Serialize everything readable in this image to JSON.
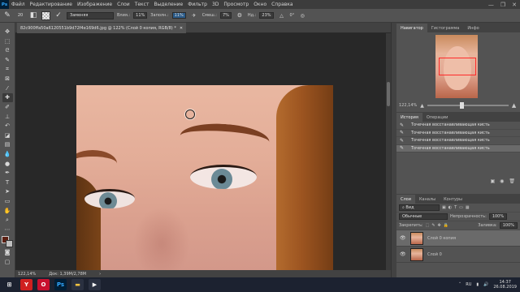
{
  "app": {
    "logo": "Ps"
  },
  "menu": [
    "Файл",
    "Редактирование",
    "Изображение",
    "Слои",
    "Текст",
    "Выделение",
    "Фильтр",
    "3D",
    "Просмотр",
    "Окно",
    "Справка"
  ],
  "window_controls": [
    "—",
    "❐",
    "✕"
  ],
  "options": {
    "brush_size": "20",
    "mode_label": "Режим:",
    "mode_value": "Заменяя",
    "flow_label": "Влия.:",
    "flow_value": "11%",
    "opacity_label": "Заполн.:",
    "opacity_value": "11%",
    "smooth_label": "Смеш.:",
    "smooth_value": "7%",
    "blur_label": "Нд.:",
    "blur_value": "23%",
    "sample_value": "0°"
  },
  "document": {
    "tab_title": "82c900ffa50a6120551b9d72f4e169d6.jpg @ 122% (Слой 0 копия, RGB/8) *",
    "close": "✕"
  },
  "statusbar": {
    "zoom": "122,14%",
    "doc": "Док: 1,39М/2,78М"
  },
  "navigator": {
    "tabs": [
      "Навигатор",
      "Гистограмма",
      "Инфо"
    ],
    "zoom": "122,14%"
  },
  "history": {
    "tabs": [
      "История",
      "Операции"
    ],
    "snapshot": "82c900ffa50a6120551b9d72f4e169d6.jpg",
    "items": [
      "Точечная восстанавливающая кисть",
      "Точечная восстанавливающая кисть",
      "Точечная восстанавливающая кисть",
      "Точечная восстанавливающая кисть"
    ]
  },
  "layers": {
    "tabs": [
      "Слои",
      "Каналы",
      "Контуры"
    ],
    "filter_label": "Вид",
    "blend_mode": "Обычные",
    "opacity_label": "Непрозрачность:",
    "opacity_value": "100%",
    "lock_label": "Закрепить:",
    "fill_label": "Заливка:",
    "fill_value": "100%",
    "items": [
      {
        "name": "Слой 0 копия",
        "active": true
      },
      {
        "name": "Слой 0",
        "active": false
      }
    ],
    "footer_icons": [
      "🔗",
      "fx",
      "◐",
      "▣",
      "📁",
      "＋",
      "🗑"
    ]
  },
  "taskbar": {
    "apps": [
      {
        "name": "start",
        "glyph": "⊞",
        "color": "#ffffff",
        "bg": "#1c2230"
      },
      {
        "name": "yandex",
        "glyph": "Y",
        "color": "#ffffff",
        "bg": "#d02020"
      },
      {
        "name": "opera",
        "glyph": "O",
        "color": "#ffffff",
        "bg": "#c8102e"
      },
      {
        "name": "photoshop",
        "glyph": "Ps",
        "color": "#31a8ff",
        "bg": "#001e36"
      },
      {
        "name": "explorer",
        "glyph": "▬",
        "color": "#f0c040",
        "bg": "#2a3040"
      },
      {
        "name": "media",
        "glyph": "▶",
        "color": "#ffffff",
        "bg": "#2a3040"
      }
    ],
    "lang": "RU",
    "time": "14:37",
    "date": "26.08.2019"
  },
  "colors": {
    "foreground": "#5b1f12",
    "background": "#c0c0c0",
    "accent": "#31a8ff"
  }
}
